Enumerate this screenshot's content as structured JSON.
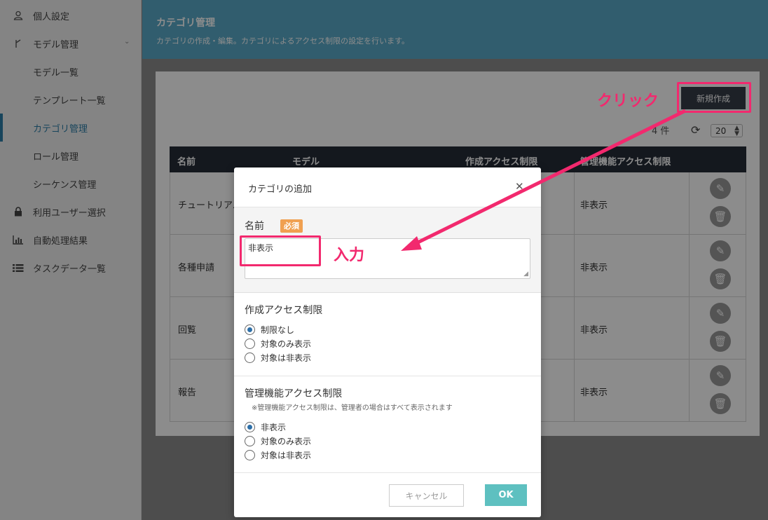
{
  "sidebar": {
    "items": [
      {
        "icon": "user-icon",
        "label": "個人設定"
      },
      {
        "icon": "branch-icon",
        "label": "モデル管理"
      },
      {
        "icon": "",
        "label": "モデル一覧"
      },
      {
        "icon": "",
        "label": "テンプレート一覧"
      },
      {
        "icon": "",
        "label": "カテゴリ管理"
      },
      {
        "icon": "",
        "label": "ロール管理"
      },
      {
        "icon": "",
        "label": "シーケンス管理"
      },
      {
        "icon": "lock-icon",
        "label": "利用ユーザー選択"
      },
      {
        "icon": "bar-chart-icon",
        "label": "自動処理結果"
      },
      {
        "icon": "list-icon",
        "label": "タスクデータ一覧"
      }
    ]
  },
  "header": {
    "title": "カテゴリ管理",
    "subtitle": "カテゴリの作成・編集。カテゴリによるアクセス制限の設定を行います。"
  },
  "toolbar": {
    "new_label": "新規作成",
    "count_text": "4 件",
    "per_page": "20"
  },
  "table": {
    "headers": [
      "名前",
      "モデル",
      "作成アクセス制限",
      "管理機能アクセス制限"
    ],
    "rows": [
      {
        "name": "チュートリアル",
        "mgmt": "非表示"
      },
      {
        "name": "各種申請",
        "mgmt": "非表示"
      },
      {
        "name": "回覧",
        "mgmt": "非表示"
      },
      {
        "name": "報告",
        "mgmt": "非表示"
      }
    ]
  },
  "modal": {
    "title": "カテゴリの追加",
    "name_label": "名前",
    "required": "必須",
    "name_value": "非表示",
    "create_label": "作成アクセス制限",
    "create_options": [
      "制限なし",
      "対象のみ表示",
      "対象は非表示"
    ],
    "create_selected": 0,
    "mgmt_label": "管理機能アクセス制限",
    "mgmt_note": "※管理機能アクセス制限は、管理者の場合はすべて表示されます",
    "mgmt_options": [
      "非表示",
      "対象のみ表示",
      "対象は非表示"
    ],
    "mgmt_selected": 0,
    "cancel_label": "キャンセル",
    "ok_label": "OK"
  },
  "annotations": {
    "click": "クリック",
    "input": "入力"
  },
  "colors": {
    "accent": "#f2296e",
    "header": "#5aaac8",
    "ok": "#5ec0c0"
  }
}
